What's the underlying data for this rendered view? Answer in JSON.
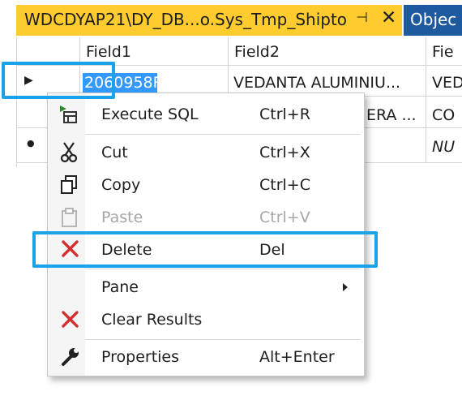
{
  "tab": {
    "title": "WDCDYAP21\\DY_DB...o.Sys_Tmp_Shipto",
    "pin_glyph": "⊣",
    "close_glyph": "✕",
    "next_tab_label": "Objec"
  },
  "grid": {
    "columns": [
      "Field1",
      "Field2",
      "Fie"
    ],
    "rows": [
      {
        "indicator": "▶",
        "cells": [
          "2060958R",
          "VEDANTA ALUMINIU...",
          "VED"
        ]
      },
      {
        "indicator": "",
        "cells": [
          "",
          "ERA ...",
          "CO"
        ]
      },
      {
        "indicator": "●",
        "cells": [
          "",
          "",
          "NU"
        ]
      }
    ]
  },
  "menu": {
    "items": [
      {
        "label": "Execute SQL",
        "shortcut": "Ctrl+R",
        "icon": "execute-sql-icon",
        "enabled": true
      },
      {
        "label": "Cut",
        "shortcut": "Ctrl+X",
        "icon": "scissors-icon",
        "enabled": true
      },
      {
        "label": "Copy",
        "shortcut": "Ctrl+C",
        "icon": "copy-icon",
        "enabled": true
      },
      {
        "label": "Paste",
        "shortcut": "Ctrl+V",
        "icon": "paste-icon",
        "enabled": false
      },
      {
        "label": "Delete",
        "shortcut": "Del",
        "icon": "delete-x-icon",
        "enabled": true
      },
      {
        "label": "Pane",
        "shortcut": "",
        "icon": "submenu-arrow-icon",
        "enabled": true
      },
      {
        "label": "Clear Results",
        "shortcut": "",
        "icon": "clear-x-icon",
        "enabled": true
      },
      {
        "label": "Properties",
        "shortcut": "Alt+Enter",
        "icon": "wrench-icon",
        "enabled": true
      }
    ]
  },
  "colors": {
    "tab_active": "#ffcc2f",
    "tab_inactive": "#1e5aa0",
    "selection": "#3399ff",
    "highlight_box": "#1aa3e8",
    "delete_red": "#d32f2f",
    "execute_green": "#2e8b2e"
  }
}
